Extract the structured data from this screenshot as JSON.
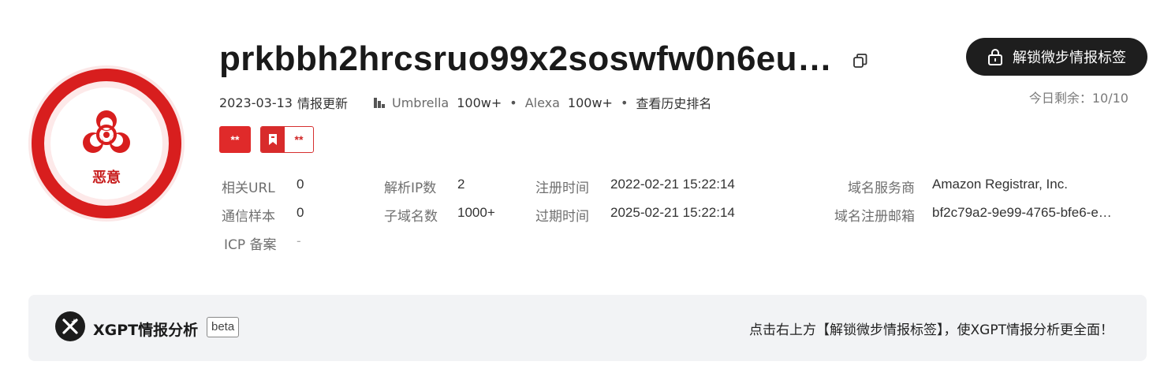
{
  "verdict": {
    "label": "恶意",
    "icon": "biohazard-icon",
    "color": "#d81e1e"
  },
  "domain": {
    "name": "prkbbh2hrcsruo99x2soswfw0n6eu…",
    "copy_icon": "copy-icon"
  },
  "meta": {
    "update_date": "2023-03-13",
    "update_text": "情报更新",
    "umbrella_label": "Umbrella",
    "umbrella_value": "100w+",
    "alexa_label": "Alexa",
    "alexa_value": "100w+",
    "separator": "•",
    "history_link": "查看历史排名"
  },
  "tags": [
    {
      "text": "**",
      "style": "filled",
      "color": "#e02a2a"
    },
    {
      "text": "**",
      "style": "outline-with-bookmark",
      "color": "#d63030"
    }
  ],
  "details": {
    "related_url": {
      "label": "相关URL",
      "value": "0"
    },
    "comm_samples": {
      "label": "通信样本",
      "value": "0"
    },
    "icp": {
      "label": "ICP 备案",
      "value": "-"
    },
    "resolved_ip": {
      "label": "解析IP数",
      "value": "2"
    },
    "subdomains": {
      "label": "子域名数",
      "value": "1000+"
    },
    "reg_time": {
      "label": "注册时间",
      "value": "2022-02-21 15:22:14"
    },
    "exp_time": {
      "label": "过期时间",
      "value": "2025-02-21 15:22:14"
    },
    "registrar": {
      "label": "域名服务商",
      "value": "Amazon Registrar, Inc."
    },
    "reg_email": {
      "label": "域名注册邮箱",
      "value": "bf2c79a2-9e99-4765-bfe6-e…"
    }
  },
  "unlock": {
    "label": "解锁微步情报标签",
    "icon": "lock-icon",
    "remaining": "今日剩余：10/10"
  },
  "xgpt": {
    "title": "XGPT情报分析",
    "badge": "beta",
    "hint": "点击右上方【解锁微步情报标签】，使XGPT情报分析更全面！"
  }
}
